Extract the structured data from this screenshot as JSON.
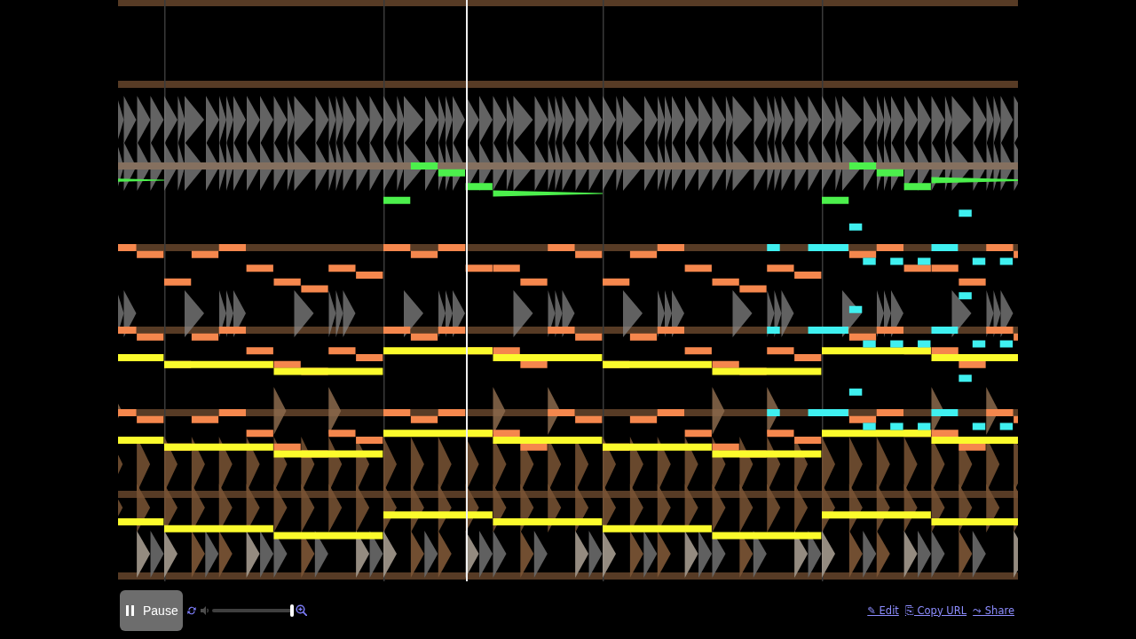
{
  "visualizer": {
    "playhead": {
      "level": 0.388
    }
  },
  "player": {
    "play_button": {
      "label": "Pause",
      "playing": true
    },
    "loop_button": {
      "on": true
    },
    "volume_slider": {
      "level": 1
    }
  },
  "links": [
    {
      "label": "✎ Edit"
    },
    {
      "label": "⎘ Copy URL"
    },
    {
      "label": "⤳ Share"
    }
  ]
}
